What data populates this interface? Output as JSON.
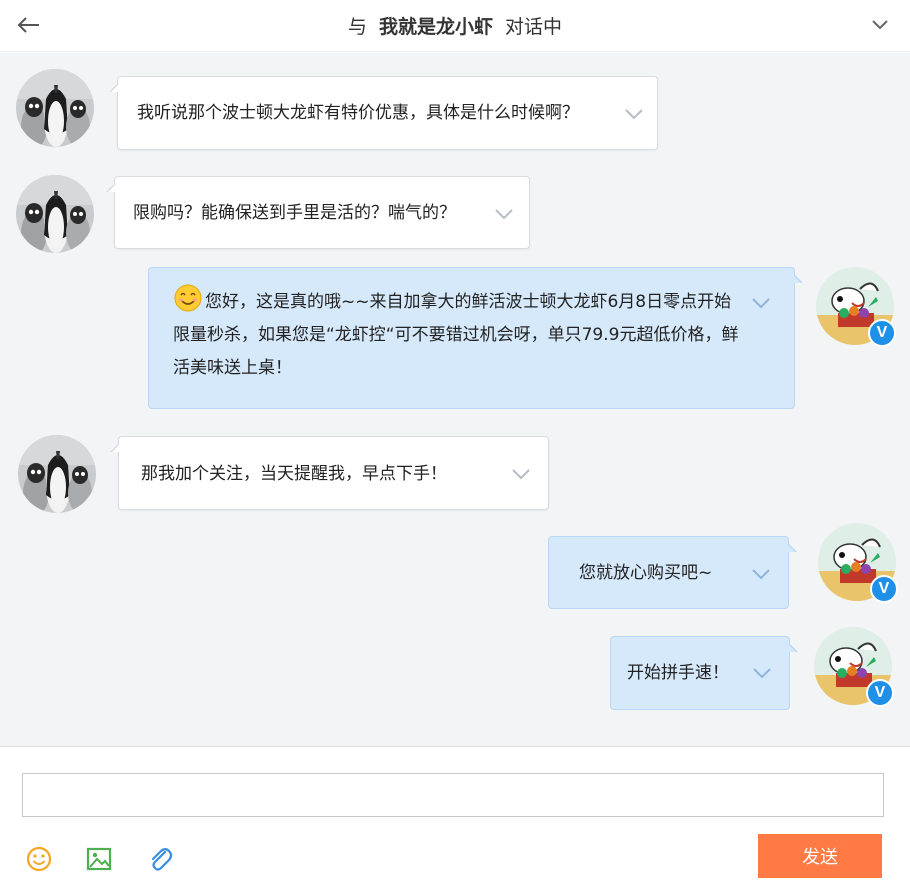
{
  "header": {
    "title_prefix": "与",
    "contact_name": "我就是龙小虾",
    "title_suffix": "对话中"
  },
  "messages": [
    {
      "side": "in",
      "text": "我听说那个波士顿大龙虾有特价优惠，具体是什么时候啊？"
    },
    {
      "side": "in",
      "text": "限购吗？能确保送到手里是活的？喘气的？"
    },
    {
      "side": "out",
      "text": "您好，这是真的哦~~来自加拿大的鲜活波士顿大龙虾6月8日零点开始限量秒杀，如果您是“龙虾控“可不要错过机会呀，单只79.9元超低价格，鲜活美味送上桌！"
    },
    {
      "side": "in",
      "text": "那我加个关注，当天提醒我，早点下手！"
    },
    {
      "side": "out",
      "text": "您就放心购买吧~"
    },
    {
      "side": "out",
      "text": "开始拼手速！"
    }
  ],
  "badge_letter": "V",
  "compose": {
    "input_value": "",
    "send_label": "发送"
  },
  "colors": {
    "incoming_bubble": "#ffffff",
    "outgoing_bubble": "#d6e9fb",
    "send_button": "#ff7a45",
    "chat_background": "#f3f4f6",
    "verified_badge": "#1e90e8"
  },
  "icons": [
    "back-arrow-icon",
    "chevron-down-icon",
    "emoji-icon",
    "image-icon",
    "attachment-icon"
  ]
}
